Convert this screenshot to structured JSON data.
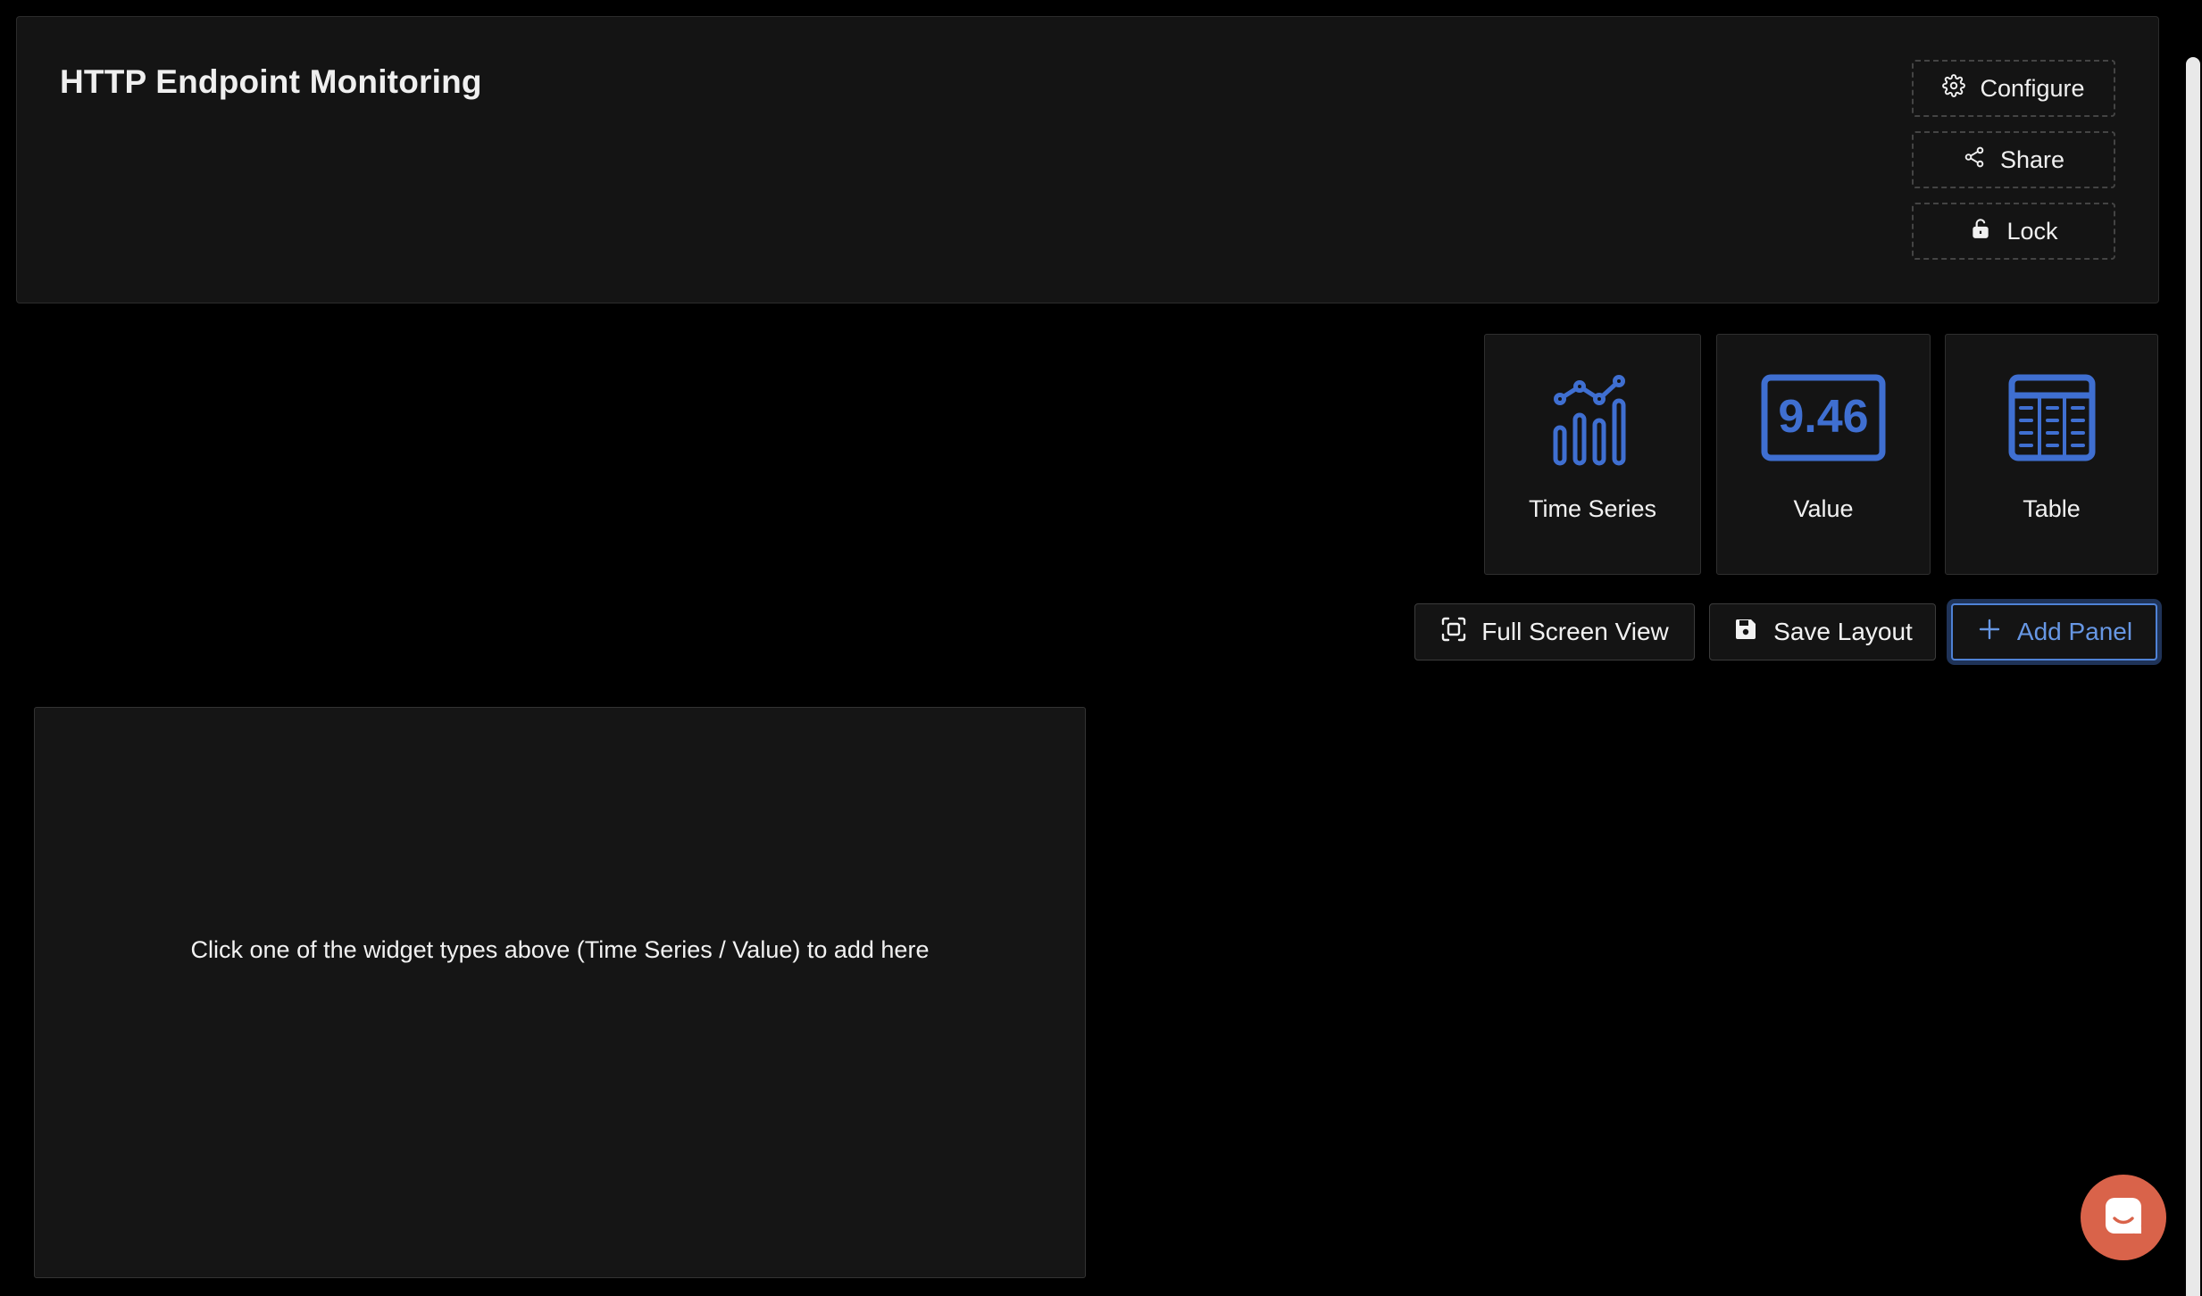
{
  "dashboard": {
    "title": "HTTP Endpoint Monitoring"
  },
  "header_actions": {
    "configure_label": "Configure",
    "share_label": "Share",
    "lock_label": "Lock"
  },
  "widget_types": {
    "time_series_label": "Time Series",
    "value_label": "Value",
    "value_sample": "9.46",
    "table_label": "Table"
  },
  "toolbar": {
    "full_screen_label": "Full Screen View",
    "save_layout_label": "Save Layout",
    "add_panel_label": "Add Panel"
  },
  "placeholder": {
    "message": "Click one of the widget types above (Time Series / Value) to add here"
  },
  "colors": {
    "background": "#000000",
    "surface": "#141414",
    "accent_blue": "#3f6fd1",
    "chat_launcher": "#d9634a"
  },
  "icons": {
    "configure": "gear-icon",
    "share": "share-icon",
    "lock": "lock-icon",
    "time_series": "bar-line-chart-icon",
    "value": "value-display-icon",
    "table": "table-icon",
    "full_screen": "fullscreen-icon",
    "save": "floppy-disk-icon",
    "add": "plus-icon",
    "chat": "chat-icon"
  }
}
